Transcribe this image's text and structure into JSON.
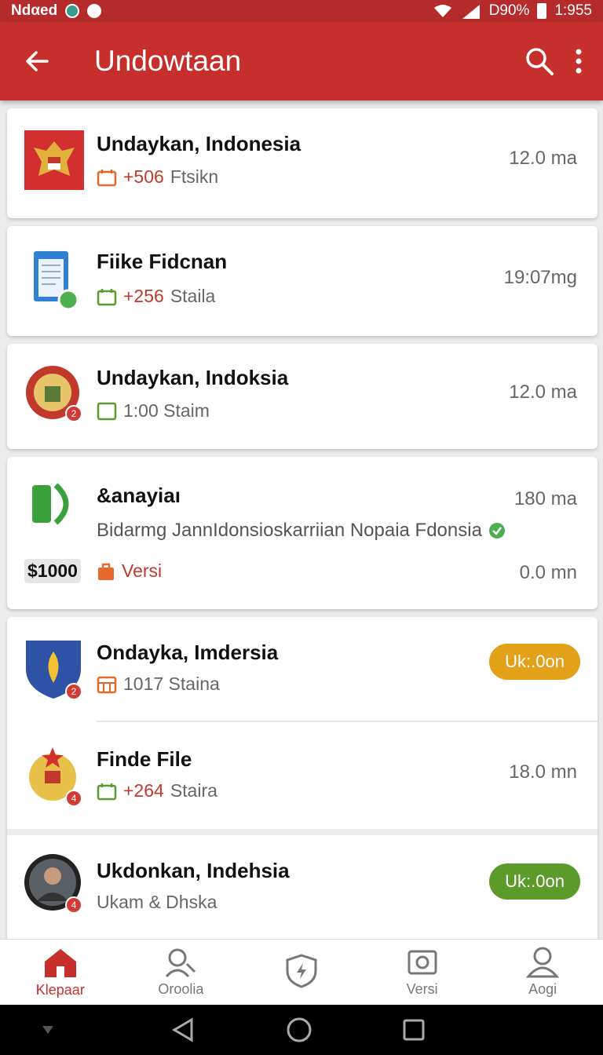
{
  "status_bar": {
    "carrier": "Ndαed",
    "battery": "D90%",
    "time": "1:955"
  },
  "app_bar": {
    "title": "Undowtaan"
  },
  "items": [
    {
      "title": "Undaykan, Indonesia",
      "accent": "+506",
      "sub": "Ftsikn",
      "meta": "12.0 ma"
    },
    {
      "title": "Fiike Fidcnan",
      "accent": "+256",
      "sub": "Staila",
      "meta": "19:07mg"
    },
    {
      "title": "Undaykan, Indoksia",
      "accent": "",
      "sub": "1:00 Staim",
      "meta": "12.0 ma"
    },
    {
      "title": "&anayiaı",
      "description": "Bidarmg JannIdonsioskarriian Nopaia Fdonsia",
      "meta": "180 ma",
      "price": "$1000",
      "footer_label": "Versi",
      "footer_meta": "0.0 mn"
    },
    {
      "title": "Ondayka, Imdersia",
      "sub": "1017 Staina",
      "pill": "Uk:.0on",
      "corner": "2"
    },
    {
      "title": "Finde File",
      "accent": "+264",
      "sub": "Staira",
      "meta": "18.0 mn",
      "corner": "4"
    },
    {
      "title": "Ukdonkan, Indehsia",
      "sub": "Ukam & Dhska",
      "pill": "Uk:.0on",
      "corner": "4"
    }
  ],
  "bottom_nav": [
    {
      "label": "Klepaar"
    },
    {
      "label": "Oroolia"
    },
    {
      "label": ""
    },
    {
      "label": "Versi"
    },
    {
      "label": "Aogi"
    }
  ],
  "colors": {
    "primary": "#c62f2c",
    "pill_orange": "#e3a019",
    "pill_green": "#5c9b2a"
  }
}
